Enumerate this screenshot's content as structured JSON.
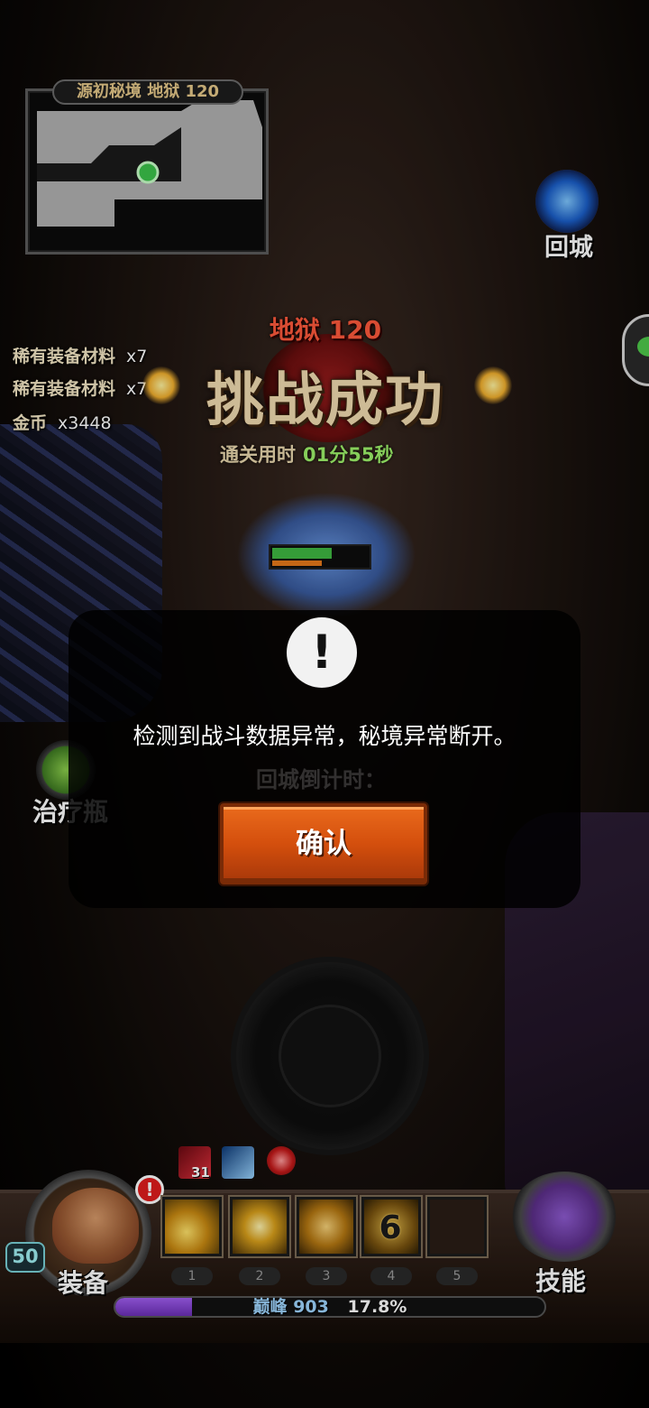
{
  "minimap": {
    "title": "源初秘境 地狱 120"
  },
  "loot": [
    {
      "name": "稀有装备材料",
      "qty": "x7"
    },
    {
      "name": "稀有装备材料",
      "qty": "x7"
    },
    {
      "name": "金币",
      "qty": "x3448"
    }
  ],
  "victory": {
    "difficulty": "地狱 120",
    "title": "挑战成功",
    "time_label": "通关用时",
    "time_value": "01分55秒"
  },
  "town": {
    "label": "回城"
  },
  "potion": {
    "label": "治疗瓶"
  },
  "monster": {
    "hp_fraction": 0.62,
    "shield_fraction": 0.52
  },
  "dialog": {
    "icon": "!",
    "message": "检测到战斗数据异常，秘境异常断开。",
    "confirm_label": "确认",
    "background_text": "回城倒计时："
  },
  "buffs": {
    "count": "31"
  },
  "hero": {
    "level": "50",
    "equip_label": "装备",
    "alert": "!"
  },
  "skills": {
    "book_label": "技能",
    "cooldown": "6",
    "keys": [
      "1",
      "2",
      "3",
      "4",
      "5"
    ]
  },
  "xp": {
    "name": "巅峰",
    "value": "903",
    "percent": "17.8%",
    "fraction": 0.178
  },
  "colors": {
    "accent_orange": "#d44f0d",
    "success_green": "#9ef36a",
    "hell_red": "#ff5a3c"
  }
}
